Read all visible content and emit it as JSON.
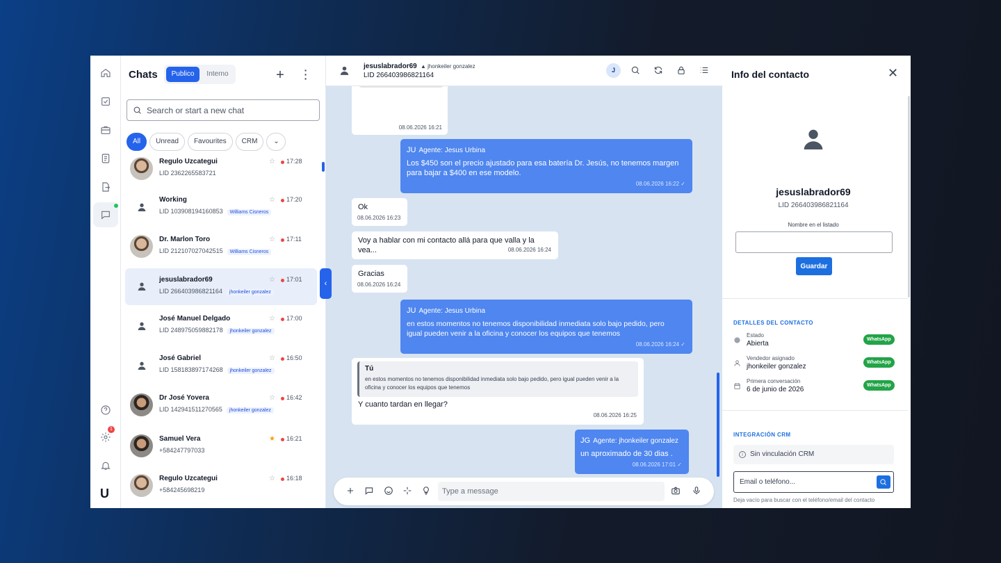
{
  "chats": {
    "title": "Chats",
    "tabs": [
      "Publico",
      "Interno"
    ],
    "search_placeholder": "Search or start a new chat",
    "filters": [
      "All",
      "Unread",
      "Favourites",
      "CRM"
    ],
    "items": [
      {
        "name": "Regulo Uzcategui",
        "sub": "LID 2362265583721",
        "time": "17:28",
        "tag": "",
        "starred": false
      },
      {
        "name": "Working",
        "sub": "LID 103908194160853",
        "time": "17:20",
        "tag": "Williams Cisneros",
        "starred": false
      },
      {
        "name": "Dr. Marlon Toro",
        "sub": "LID 212107027042515",
        "time": "17:11",
        "tag": "Williams Cisneros",
        "starred": false
      },
      {
        "name": "jesuslabrador69",
        "sub": "LID 266403986821164",
        "time": "17:01",
        "tag": "jhonkeiler gonzalez",
        "starred": false
      },
      {
        "name": "José Manuel Delgado",
        "sub": "LID 248975059882178",
        "time": "17:00",
        "tag": "jhonkeiler gonzalez",
        "starred": false
      },
      {
        "name": "José Gabriel",
        "sub": "LID 158183897174268",
        "time": "16:50",
        "tag": "jhonkeiler gonzalez",
        "starred": false
      },
      {
        "name": "Dr José Yovera",
        "sub": "LID 142941511270565",
        "time": "16:42",
        "tag": "jhonkeiler gonzalez",
        "starred": false
      },
      {
        "name": "Samuel Vera",
        "sub": "+584247797033",
        "time": "16:21",
        "tag": "",
        "starred": true
      },
      {
        "name": "Regulo Uzcategui",
        "sub": "+584245698219",
        "time": "16:18",
        "tag": "",
        "starred": false
      }
    ]
  },
  "rail": {
    "settings_badge": "1",
    "logo": "U"
  },
  "conversation": {
    "contact_name": "jesuslabrador69",
    "agent": "jhonkeiler gonzalez",
    "lid": "LID 266403986821164",
    "avatar_initial": "J",
    "composer_placeholder": "Type a message",
    "messages": [
      {
        "dir": "in",
        "kind": "image",
        "time": "08.06.2026 16:21"
      },
      {
        "dir": "out",
        "initials": "JU",
        "agent": "Agente: Jesus Urbina",
        "text": "Los $450 son el precio ajustado para esa batería Dr. Jesús, no tenemos margen para bajar a $400 en ese modelo.",
        "time": "08.06.2026 16:22"
      },
      {
        "dir": "in",
        "text": "Ok",
        "time": "08.06.2026 16:23"
      },
      {
        "dir": "in",
        "text": "Voy a hablar con mi contacto allá para que valla y la vea...",
        "time": "08.06.2026 16:24"
      },
      {
        "dir": "in",
        "text": "Gracias",
        "time": "08.06.2026 16:24"
      },
      {
        "dir": "out",
        "initials": "JU",
        "agent": "Agente: Jesus Urbina",
        "text": "en estos momentos no tenemos disponibilidad inmediata solo bajo pedido, pero igual pueden venir a la oficina y conocer los equipos que tenemos",
        "time": "08.06.2026 16:24"
      },
      {
        "dir": "in",
        "quote_name": "Tú",
        "quote_text": "en estos momentos no tenemos disponibilidad inmediata solo bajo pedido, pero igual pueden venir a la oficina y conocer los equipos que tenemos",
        "text": "Y cuanto tardan en llegar?",
        "time": "08.06.2026 16:25"
      },
      {
        "dir": "out",
        "initials": "JG",
        "agent": "Agente: jhonkeiler gonzalez",
        "text": "un aproximado de 30 dias  .",
        "time": "08.06.2026 17:01"
      }
    ]
  },
  "info": {
    "title": "Info del contacto",
    "name": "jesuslabrador69",
    "lid": "LID 266403986821164",
    "list_name_label": "Nombre en el listado",
    "save_label": "Guardar",
    "details_title": "DETALLES DEL CONTACTO",
    "details": [
      {
        "label": "Estado",
        "value": "Abierta",
        "badge": "WhatsApp"
      },
      {
        "label": "Vendedor asignado",
        "value": "jhonkeiler gonzalez",
        "badge": "WhatsApp"
      },
      {
        "label": "Primera conversación",
        "value": "6 de junio de 2026",
        "badge": "WhatsApp"
      }
    ],
    "crm_title": "INTEGRACIÓN CRM",
    "crm_status": "Sin vinculación CRM",
    "crm_placeholder": "Email o teléfono...",
    "crm_hint": "Deja vacío para buscar con el teléfono/email del contacto"
  },
  "colors": {
    "accent": "#2563eb",
    "outgoing_bubble": "#4f86ef",
    "chat_bg": "#d7e3f1",
    "whatsapp_badge": "#22a447",
    "unread_dot": "#ef4444"
  }
}
